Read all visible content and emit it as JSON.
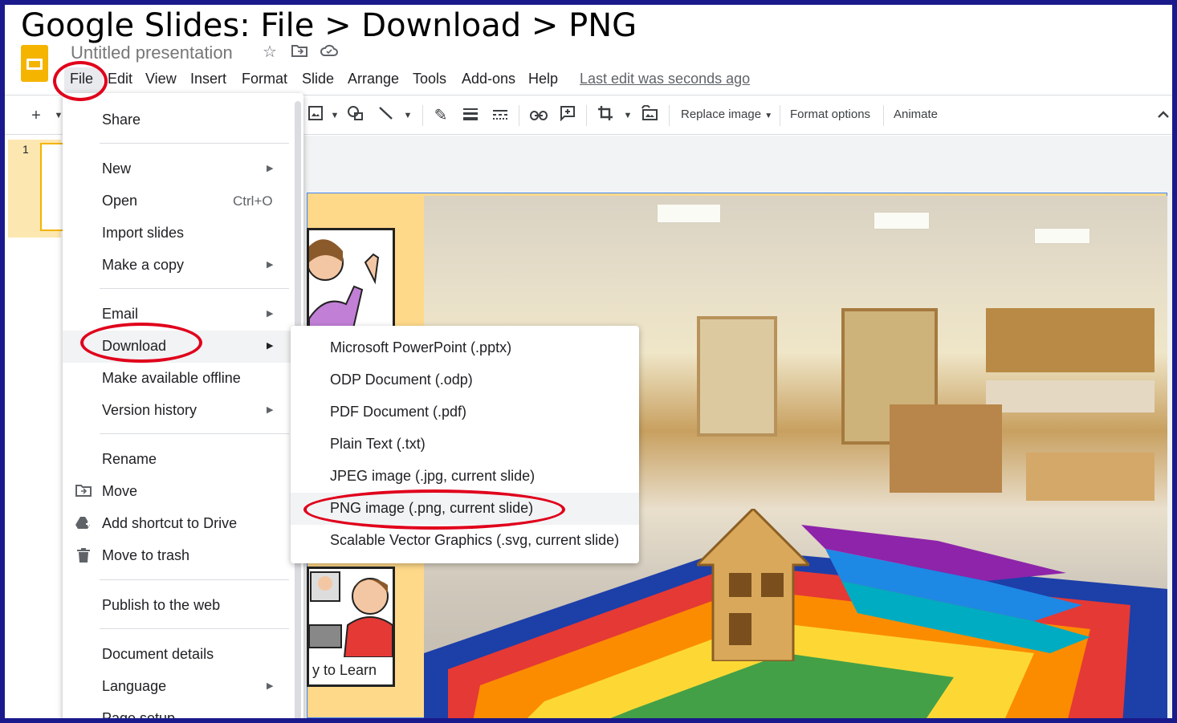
{
  "page_title": "Google Slides: File > Download > PNG",
  "doc_title": "Untitled presentation",
  "title_icons": [
    "star-icon",
    "move-to-folder-icon",
    "cloud-status-icon"
  ],
  "menubar": {
    "items": [
      "File",
      "Edit",
      "View",
      "Insert",
      "Format",
      "Slide",
      "Arrange",
      "Tools",
      "Add-ons",
      "Help"
    ],
    "last_edit": "Last edit was seconds ago"
  },
  "toolbar": {
    "replace_image": "Replace image",
    "format_options": "Format options",
    "animate": "Animate"
  },
  "filmstrip": {
    "slide_number": "1"
  },
  "slide": {
    "card_text": "y to Learn"
  },
  "file_menu": {
    "share": "Share",
    "new": "New",
    "open": "Open",
    "open_shortcut": "Ctrl+O",
    "import_slides": "Import slides",
    "make_copy": "Make a copy",
    "email": "Email",
    "download": "Download",
    "make_offline": "Make available offline",
    "version_history": "Version history",
    "rename": "Rename",
    "move": "Move",
    "add_shortcut": "Add shortcut to Drive",
    "move_to_trash": "Move to trash",
    "publish": "Publish to the web",
    "document_details": "Document details",
    "language": "Language",
    "page_setup": "Page setup"
  },
  "download_menu": {
    "items": [
      "Microsoft PowerPoint (.pptx)",
      "ODP Document (.odp)",
      "PDF Document (.pdf)",
      "Plain Text (.txt)",
      "JPEG image (.jpg, current slide)",
      "PNG image (.png, current slide)",
      "Scalable Vector Graphics (.svg, current slide)"
    ],
    "highlighted_index": 5
  },
  "colors": {
    "annotation": "#e0001b",
    "brand": "#f4b400",
    "frame": "#1a1a8c"
  }
}
